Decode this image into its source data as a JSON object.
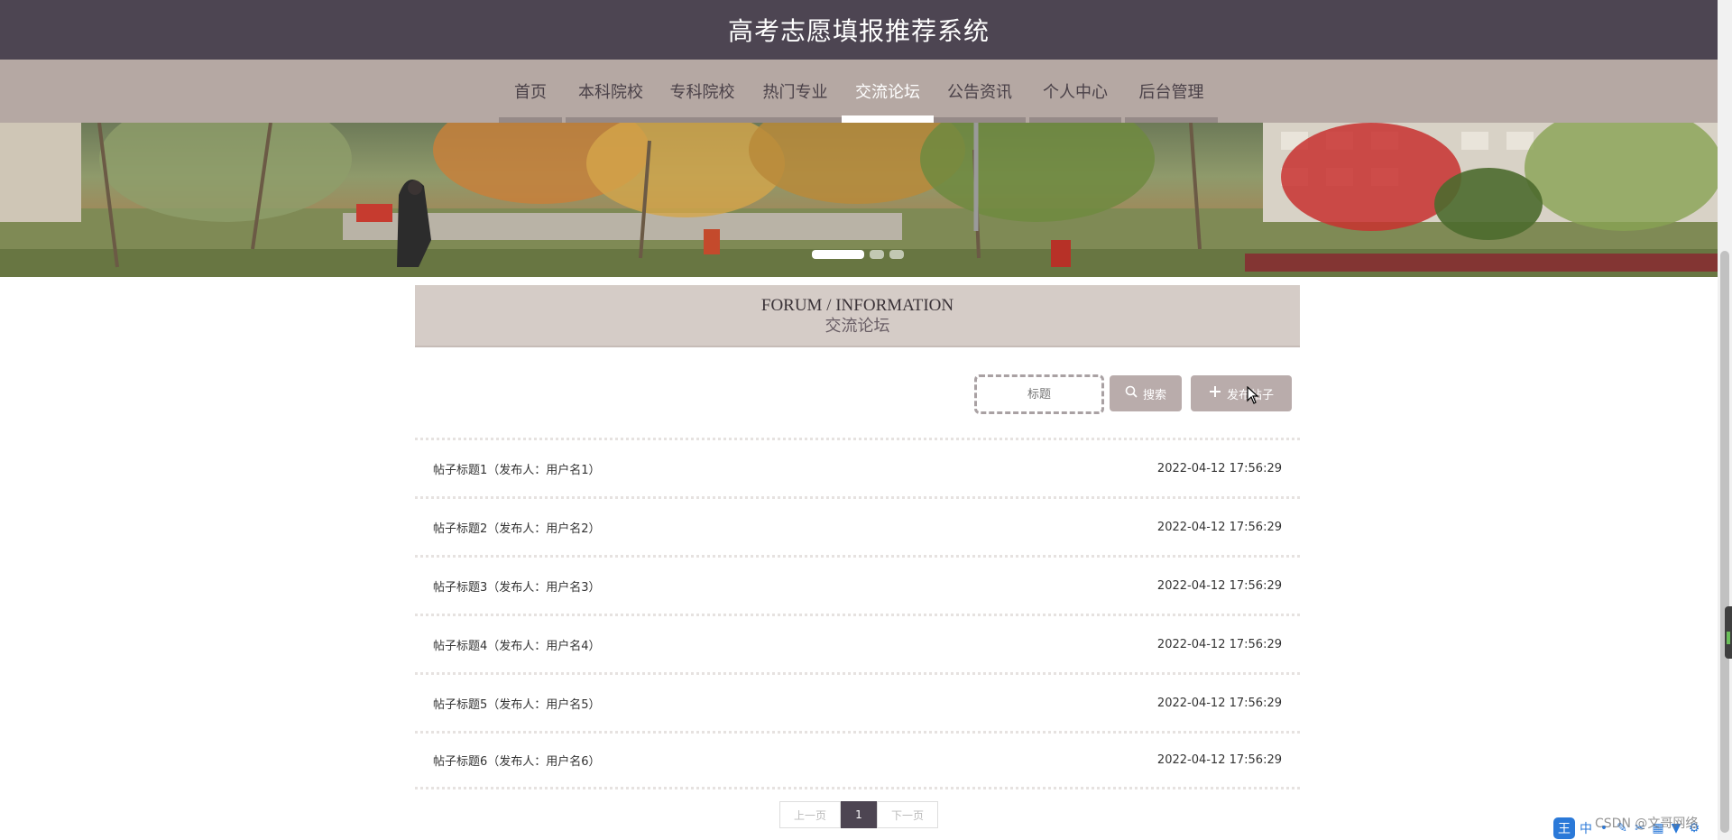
{
  "site": {
    "title": "高考志愿填报推荐系统"
  },
  "nav": {
    "items": [
      {
        "label": "首页"
      },
      {
        "label": "本科院校"
      },
      {
        "label": "专科院校"
      },
      {
        "label": "热门专业"
      },
      {
        "label": "交流论坛",
        "active": true
      },
      {
        "label": "公告资讯"
      },
      {
        "label": "个人中心"
      },
      {
        "label": "后台管理"
      }
    ]
  },
  "banner": {
    "slides": 3,
    "active_slide": 1
  },
  "section": {
    "title_en": "FORUM / INFORMATION",
    "title_zh": "交流论坛"
  },
  "toolbar": {
    "search_placeholder": "标题",
    "search_label": "搜索",
    "post_label": "发布帖子"
  },
  "posts": [
    {
      "title": "帖子标题1（发布人：用户名1）",
      "time": "2022-04-12 17:56:29"
    },
    {
      "title": "帖子标题2（发布人：用户名2）",
      "time": "2022-04-12 17:56:29"
    },
    {
      "title": "帖子标题3（发布人：用户名3）",
      "time": "2022-04-12 17:56:29"
    },
    {
      "title": "帖子标题4（发布人：用户名4）",
      "time": "2022-04-12 17:56:29"
    },
    {
      "title": "帖子标题5（发布人：用户名5）",
      "time": "2022-04-12 17:56:29"
    },
    {
      "title": "帖子标题6（发布人：用户名6）",
      "time": "2022-04-12 17:56:29"
    }
  ],
  "pagination": {
    "prev": "上一页",
    "current": "1",
    "next": "下一页"
  },
  "tray": {
    "ime_label": "中",
    "watermark": "CSDN @文哥网络"
  },
  "colors": {
    "header_bg": "#4d4552",
    "nav_bg": "#b5a8a3",
    "section_bg": "#d5ccc7",
    "button_bg": "#b9acab"
  }
}
